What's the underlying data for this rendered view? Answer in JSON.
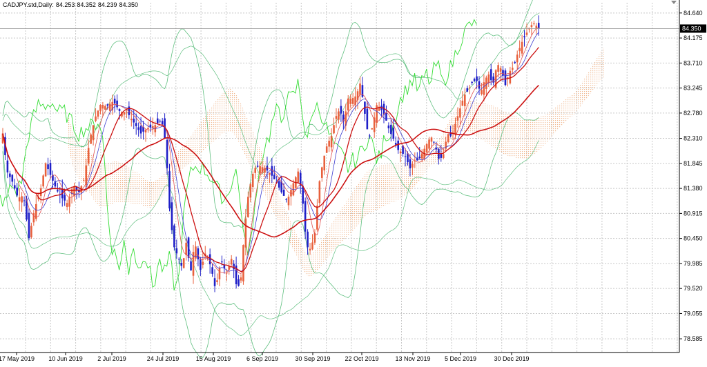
{
  "header": {
    "symbol": "CADJPY.std,Daily:",
    "open": "84.253",
    "high": "84.352",
    "low": "84.239",
    "close": "84.350"
  },
  "chart_data": {
    "type": "candlestick",
    "symbol": "CADJPY.std",
    "timeframe": "Daily",
    "ylim": [
      78.33,
      84.83
    ],
    "y_ticks": [
      "84.640",
      "84.175",
      "83.710",
      "83.245",
      "82.780",
      "82.310",
      "81.845",
      "81.380",
      "80.915",
      "80.450",
      "79.985",
      "79.520",
      "79.055",
      "78.585"
    ],
    "current_price_label": "84.350",
    "current_price": 84.35,
    "x_labels": [
      "17 May 2019",
      "10 Jun 2019",
      "2 Jul 2019",
      "24 Jul 2019",
      "15 Aug 2019",
      "6 Sep 2019",
      "30 Sep 2019",
      "22 Oct 2019",
      "13 Nov 2019",
      "5 Dec 2019",
      "30 Dec 2019"
    ],
    "colors": {
      "bull": "#e8603c",
      "bear": "#1f1fc8",
      "ma_red": "#cc1111",
      "ma_thin_red": "#e05050",
      "kijun_blue": "#3a3ad0",
      "chikou_green": "#33dd33",
      "bands_green": "#5fbf7f",
      "cloud": "#f0b890",
      "grid": "#c8c8c8",
      "price_line": "#9a9a9a"
    },
    "grid": true
  }
}
